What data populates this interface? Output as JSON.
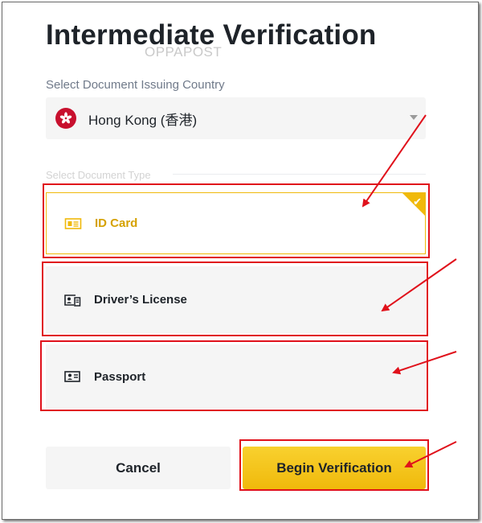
{
  "page": {
    "title": "Intermediate Verification",
    "watermark": "OPPAPOST"
  },
  "country": {
    "label": "Select Document Issuing Country",
    "selected": "Hong Kong (香港)",
    "flag_icon": "hong-kong-flag-icon"
  },
  "document_type": {
    "label": "Select Document Type",
    "options": [
      {
        "label": "ID Card",
        "icon": "id-card-icon",
        "selected": true
      },
      {
        "label": "Driver’s License",
        "icon": "drivers-license-icon",
        "selected": false
      },
      {
        "label": "Passport",
        "icon": "passport-icon",
        "selected": false
      }
    ]
  },
  "buttons": {
    "cancel": "Cancel",
    "begin": "Begin Verification"
  },
  "colors": {
    "accent": "#F0B90B",
    "selected_text": "#D5A100",
    "annotation_red": "#E0111B",
    "text": "#1E2329",
    "muted": "#707A8A",
    "field_bg": "#F5F5F5"
  }
}
